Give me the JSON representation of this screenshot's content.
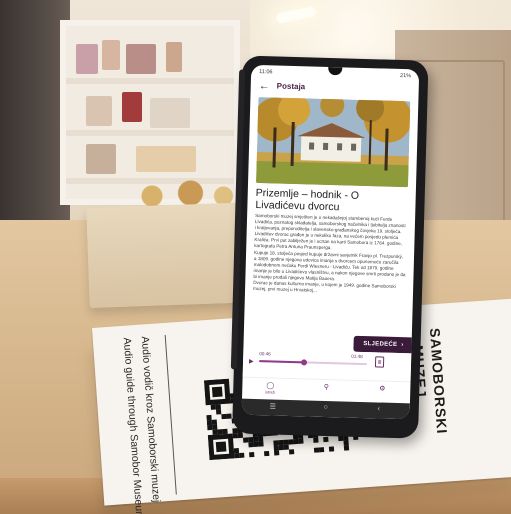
{
  "phone": {
    "status": {
      "time": "11:06",
      "right": "21%"
    },
    "appbar": {
      "title": "Postaja",
      "back_icon": "arrow-left-icon"
    },
    "heading": "Prizemlje – hodnik - O Livadićevu dvorcu",
    "paragraphs": [
      "Samoborski muzej smješten je u nekadašnjoj stambenoj kući Ferde Livadića, poznatog skladatelja, samoborskog načelnika i ljubitelja znanosti i kraljevanja, preporoditelja i slavensko-građanskog čovjeka 19. stoljeća.",
      "Livadićev dvorac građen je u nekoliko faza, na većem posjedu plemića Kralića. Prvi put zabilježen je i ucrtan na karti Samobora iz 1764. godine, kartografa Petra Antuna Praunsperga.",
      "Kupuje 18. stoljeća posjed kupuje državni savjetnik Franjo pl. Trezpurský, a 1809. godine njegova udovica imanja s dvorcem opunomoću zaručila malodobnom nećaku Ferdi Wiesneru - Livadiću. Tek od 1879. godine imanje je bilo u Livadićevu vlasništvu, a nakon njegove smrti prodano je da bi imanje prodali njegovu Matija Bauera.",
      "Dvorac je danas kulturno imanje, u kojem je 1949. godine Samoborski muzej, prvi muzej u Hrvatskoj..."
    ],
    "next_label": "SLJEDEĆE",
    "next_icon": "chevron-right-icon",
    "audio": {
      "start": "00:46",
      "end": "01:48",
      "progress": 0.42
    },
    "nav": [
      {
        "label": "istraži",
        "icon": "compass-icon"
      },
      {
        "label": "",
        "icon": "person-icon"
      },
      {
        "label": "",
        "icon": "gear-icon"
      }
    ]
  },
  "card": {
    "lines": [
      "Audio vodič kroz Samoborski muzej",
      "Audio guide through Samobor Museum",
      "Samoborski muzej"
    ],
    "brand": [
      "SAMOBORSKI",
      "MUZEJ"
    ]
  },
  "colors": {
    "accent": "#6a2f66",
    "button": "#3a1c3a"
  }
}
